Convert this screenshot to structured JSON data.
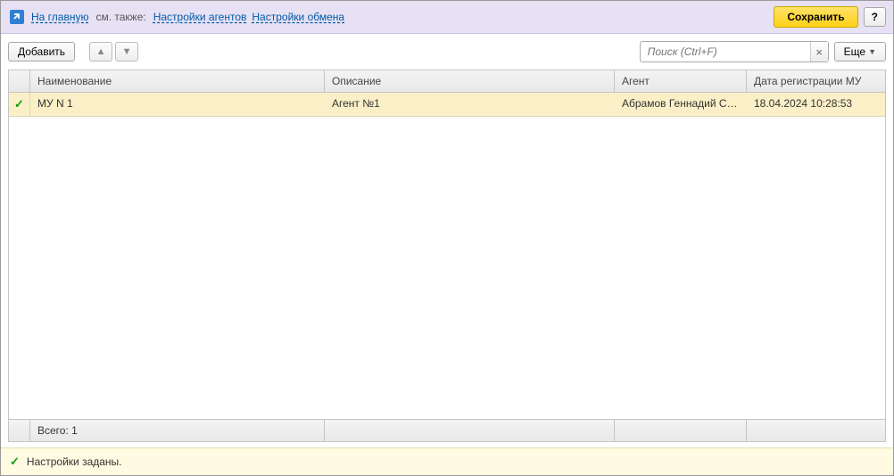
{
  "topbar": {
    "home_link": "На главную",
    "see_also": "см. также:",
    "agents_link": "Настройки агентов",
    "exchange_link": "Настройки обмена",
    "save_label": "Сохранить",
    "help_label": "?"
  },
  "toolbar": {
    "add_label": "Добавить",
    "search_placeholder": "Поиск (Ctrl+F)",
    "clear_label": "×",
    "more_label": "Еще"
  },
  "table": {
    "columns": {
      "name": "Наименование",
      "description": "Описание",
      "agent": "Агент",
      "reg_date": "Дата регистрации МУ"
    },
    "rows": [
      {
        "checked": true,
        "name": "МУ N 1",
        "description": "Агент №1",
        "agent": "Абрамов Геннадий Сер...",
        "reg_date": "18.04.2024 10:28:53"
      }
    ],
    "footer": {
      "total": "Всего: 1"
    }
  },
  "status": {
    "message": "Настройки заданы."
  }
}
